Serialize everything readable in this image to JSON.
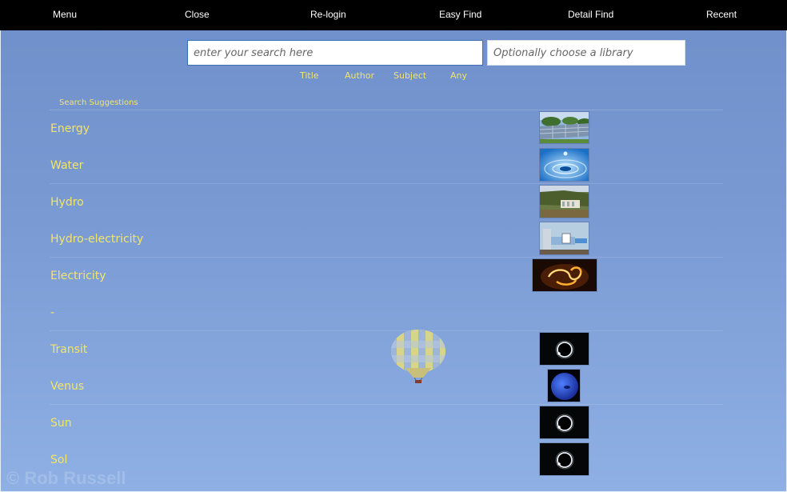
{
  "nav": {
    "menu": "Menu",
    "close": "Close",
    "relogin": "Re-login",
    "easy_find": "Easy Find",
    "detail_find": "Detail Find",
    "recent": "Recent"
  },
  "search": {
    "placeholder": "enter your search here",
    "value": "",
    "library_placeholder": "Optionally choose a library",
    "library_value": ""
  },
  "filters": [
    "Title",
    "Author",
    "Subject",
    "Any"
  ],
  "suggestions_label": "Search Suggestions",
  "suggestions": [
    {
      "label": "Energy",
      "thumb": "solar-panels-image"
    },
    {
      "label": "Water",
      "thumb": "water-drop-image"
    },
    {
      "label": "Hydro",
      "thumb": "hydro-dam-image"
    },
    {
      "label": "Hydro-electricity",
      "thumb": "hydro-plant-diagram-image"
    },
    {
      "label": "Electricity",
      "thumb": "electric-light-image"
    },
    {
      "label": "-",
      "thumb": ""
    },
    {
      "label": "Transit",
      "thumb": "solar-eclipse-image"
    },
    {
      "label": "Venus",
      "thumb": "blue-planet-image"
    },
    {
      "label": "Sun",
      "thumb": "solar-eclipse-image"
    },
    {
      "label": "Sol",
      "thumb": "solar-eclipse-image"
    }
  ],
  "watermark": "© Rob Russell",
  "colors": {
    "topbar": "#000000",
    "accent_text": "#f2e56a",
    "background": "#7a9ad4"
  }
}
